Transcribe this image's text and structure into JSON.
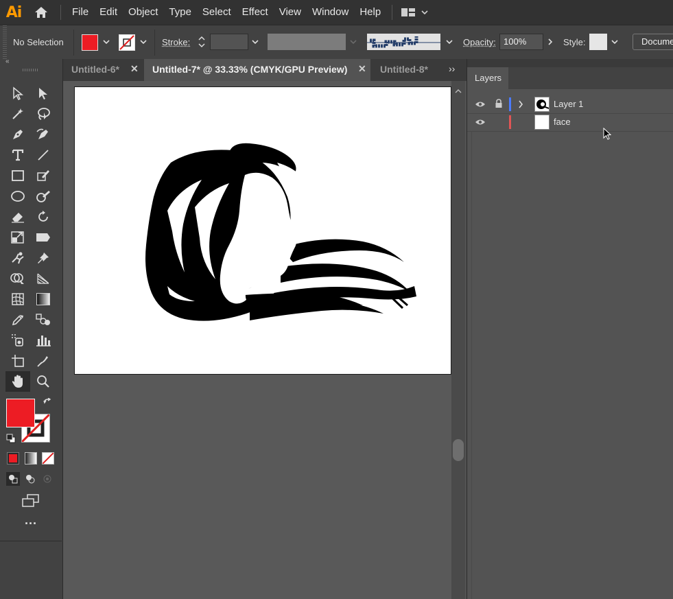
{
  "app": {
    "logo": "Ai"
  },
  "menu": [
    "File",
    "Edit",
    "Object",
    "Type",
    "Select",
    "Effect",
    "View",
    "Window",
    "Help"
  ],
  "control": {
    "selection": "No Selection",
    "stroke_label": "Stroke:",
    "opacity_label": "Opacity:",
    "opacity_value": "100%",
    "style_label": "Style:",
    "document_label": "Docume"
  },
  "tabs": [
    {
      "label": "Untitled-6*"
    },
    {
      "label": "Untitled-7* @ 33.33% (CMYK/GPU Preview)"
    },
    {
      "label": "Untitled-8*"
    }
  ],
  "layers_panel": {
    "title": "Layers",
    "layers": [
      {
        "name": "Layer 1",
        "color": "#4b7bff"
      },
      {
        "name": "face",
        "color": "#e05555"
      }
    ]
  },
  "colors": {
    "fill": "#ed1c24",
    "brand": "#ff9a00"
  },
  "icons": [
    "home-icon",
    "workspace-icon",
    "selection-tool-icon",
    "direct-selection-tool-icon",
    "magic-wand-icon",
    "lasso-icon",
    "pen-tool-icon",
    "curvature-tool-icon",
    "type-tool-icon",
    "line-tool-icon",
    "rectangle-tool-icon",
    "paintbrush-icon",
    "ellipse-tool-icon",
    "blob-brush-icon",
    "eraser-icon",
    "rotate-icon",
    "scale-icon",
    "warp-icon",
    "puppet-warp-icon",
    "pin-icon",
    "shape-builder-icon",
    "perspective-icon",
    "mesh-icon",
    "gradient-icon",
    "eyedropper-icon",
    "blend-icon",
    "symbol-sprayer-icon",
    "column-graph-icon",
    "artboard-tool-icon",
    "slice-icon",
    "hand-tool-icon",
    "zoom-tool-icon",
    "swap-colors-icon",
    "default-colors-icon",
    "visibility-eye-icon",
    "lock-icon",
    "expand-chevron-icon",
    "more-tools-icon"
  ]
}
